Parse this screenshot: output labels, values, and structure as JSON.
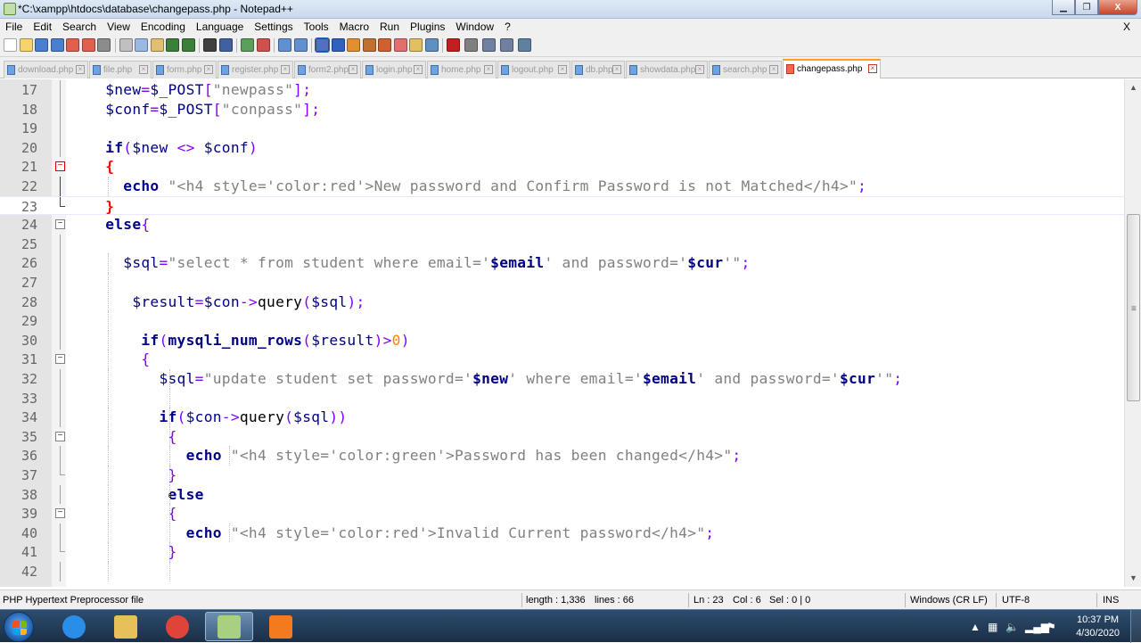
{
  "window": {
    "title": "*C:\\xampp\\htdocs\\database\\changepass.php - Notepad++",
    "app_icon": "notepadpp-icon",
    "buttons": [
      "minimize-icon",
      "maximize-icon",
      "close-icon"
    ],
    "close_glyph": "X"
  },
  "menubar": {
    "items": [
      "File",
      "Edit",
      "Search",
      "View",
      "Encoding",
      "Language",
      "Settings",
      "Tools",
      "Macro",
      "Run",
      "Plugins",
      "Window",
      "?"
    ],
    "close_doc": "X"
  },
  "toolbar": {
    "icons": [
      "new-file-icon",
      "open-file-icon",
      "save-icon",
      "save-all-icon",
      "close-icon",
      "close-all-icon",
      "print-icon",
      "cut-icon",
      "copy-icon",
      "paste-icon",
      "undo-icon",
      "redo-icon",
      "find-icon",
      "replace-icon",
      "zoom-in-icon",
      "zoom-out-icon",
      "sync-vertical-icon",
      "sync-horizontal-icon",
      "word-wrap-icon",
      "all-chars-icon",
      "indent-guide-icon",
      "user-lang-icon",
      "doc-map-icon",
      "function-list-icon",
      "folder-workspace-icon",
      "monitoring-icon",
      "record-macro-icon",
      "stop-record-icon",
      "playback-icon",
      "run-macro-multiple-icon",
      "save-macro-icon"
    ]
  },
  "tabs": [
    {
      "label": "download.php",
      "active": false
    },
    {
      "label": "file.php",
      "active": false
    },
    {
      "label": "form.php",
      "active": false
    },
    {
      "label": "register.php",
      "active": false
    },
    {
      "label": "form2.php",
      "active": false
    },
    {
      "label": "login.php",
      "active": false
    },
    {
      "label": "home.php",
      "active": false
    },
    {
      "label": "logout.php",
      "active": false
    },
    {
      "label": "db.php",
      "active": false
    },
    {
      "label": "showdata.php",
      "active": false
    },
    {
      "label": "search.php",
      "active": false
    },
    {
      "label": "changepass.php",
      "active": true
    }
  ],
  "editor": {
    "lines": [
      {
        "n": "17",
        "fold": "line",
        "tokens": [
          [
            "",
            "    "
          ],
          [
            "var",
            "$new"
          ],
          [
            "op",
            "="
          ],
          [
            "var",
            "$_POST"
          ],
          [
            "op",
            "["
          ],
          [
            "str",
            "\"newpass\""
          ],
          [
            "op",
            "];"
          ]
        ]
      },
      {
        "n": "18",
        "fold": "line",
        "tokens": [
          [
            "",
            "    "
          ],
          [
            "var",
            "$conf"
          ],
          [
            "op",
            "="
          ],
          [
            "var",
            "$_POST"
          ],
          [
            "op",
            "["
          ],
          [
            "str",
            "\"conpass\""
          ],
          [
            "op",
            "];"
          ]
        ]
      },
      {
        "n": "19",
        "fold": "line",
        "tokens": []
      },
      {
        "n": "20",
        "fold": "line",
        "tokens": [
          [
            "",
            "    "
          ],
          [
            "kw",
            "if"
          ],
          [
            "op",
            "("
          ],
          [
            "var",
            "$new"
          ],
          [
            "",
            " "
          ],
          [
            "op",
            "<>"
          ],
          [
            "",
            " "
          ],
          [
            "var",
            "$conf"
          ],
          [
            "op",
            ")"
          ]
        ]
      },
      {
        "n": "21",
        "fold": "box-red",
        "tokens": [
          [
            "",
            "    "
          ],
          [
            "brace-hl",
            "{"
          ]
        ]
      },
      {
        "n": "22",
        "fold": "line-red",
        "tokens": [
          [
            "",
            "      "
          ],
          [
            "kw",
            "echo"
          ],
          [
            "",
            " "
          ],
          [
            "str",
            "\"<h4 style='color:red'>New password and Confirm Password is not Matched</h4>\""
          ],
          [
            "op",
            ";"
          ]
        ]
      },
      {
        "n": "23",
        "fold": "end-red",
        "caret": true,
        "tokens": [
          [
            "",
            "    "
          ],
          [
            "brace-hl",
            "}"
          ]
        ]
      },
      {
        "n": "24",
        "fold": "box",
        "tokens": [
          [
            "",
            "    "
          ],
          [
            "kw",
            "else"
          ],
          [
            "brace",
            "{"
          ]
        ]
      },
      {
        "n": "25",
        "fold": "line",
        "tokens": []
      },
      {
        "n": "26",
        "fold": "line",
        "tokens": [
          [
            "",
            "      "
          ],
          [
            "var",
            "$sql"
          ],
          [
            "op",
            "="
          ],
          [
            "str",
            "\"select * from student where email='"
          ],
          [
            "strv",
            "$email"
          ],
          [
            "str",
            "' and password='"
          ],
          [
            "strv",
            "$cur"
          ],
          [
            "str",
            "'\""
          ],
          [
            "op",
            ";"
          ]
        ]
      },
      {
        "n": "27",
        "fold": "line",
        "tokens": []
      },
      {
        "n": "28",
        "fold": "line",
        "tokens": [
          [
            "",
            "       "
          ],
          [
            "var",
            "$result"
          ],
          [
            "op",
            "="
          ],
          [
            "var",
            "$con"
          ],
          [
            "op",
            "->"
          ],
          [
            "",
            "query"
          ],
          [
            "op",
            "("
          ],
          [
            "var",
            "$sql"
          ],
          [
            "op",
            ");"
          ]
        ]
      },
      {
        "n": "29",
        "fold": "line",
        "tokens": []
      },
      {
        "n": "30",
        "fold": "line",
        "tokens": [
          [
            "",
            "        "
          ],
          [
            "kw",
            "if"
          ],
          [
            "op",
            "("
          ],
          [
            "fn",
            "mysqli_num_rows"
          ],
          [
            "op",
            "("
          ],
          [
            "var",
            "$result"
          ],
          [
            "op",
            ")>"
          ],
          [
            "num",
            "0"
          ],
          [
            "op",
            ")"
          ]
        ]
      },
      {
        "n": "31",
        "fold": "box",
        "tokens": [
          [
            "",
            "        "
          ],
          [
            "brace",
            "{"
          ]
        ]
      },
      {
        "n": "32",
        "fold": "line",
        "tokens": [
          [
            "",
            "          "
          ],
          [
            "var",
            "$sql"
          ],
          [
            "op",
            "="
          ],
          [
            "str",
            "\"update student set password='"
          ],
          [
            "strv",
            "$new"
          ],
          [
            "str",
            "' where email='"
          ],
          [
            "strv",
            "$email"
          ],
          [
            "str",
            "' and password='"
          ],
          [
            "strv",
            "$cur"
          ],
          [
            "str",
            "'\""
          ],
          [
            "op",
            ";"
          ]
        ]
      },
      {
        "n": "33",
        "fold": "line",
        "tokens": []
      },
      {
        "n": "34",
        "fold": "line",
        "tokens": [
          [
            "",
            "          "
          ],
          [
            "kw",
            "if"
          ],
          [
            "op",
            "("
          ],
          [
            "var",
            "$con"
          ],
          [
            "op",
            "->"
          ],
          [
            "",
            "query"
          ],
          [
            "op",
            "("
          ],
          [
            "var",
            "$sql"
          ],
          [
            "op",
            "))"
          ]
        ]
      },
      {
        "n": "35",
        "fold": "box",
        "tokens": [
          [
            "",
            "           "
          ],
          [
            "brace",
            "{"
          ]
        ]
      },
      {
        "n": "36",
        "fold": "line",
        "tokens": [
          [
            "",
            "             "
          ],
          [
            "kw",
            "echo"
          ],
          [
            "",
            " "
          ],
          [
            "str",
            "\"<h4 style='color:green'>Password has been changed</h4>\""
          ],
          [
            "op",
            ";"
          ]
        ]
      },
      {
        "n": "37",
        "fold": "end",
        "tokens": [
          [
            "",
            "           "
          ],
          [
            "brace",
            "}"
          ]
        ]
      },
      {
        "n": "38",
        "fold": "line",
        "tokens": [
          [
            "",
            "           "
          ],
          [
            "kw",
            "else"
          ]
        ]
      },
      {
        "n": "39",
        "fold": "box",
        "tokens": [
          [
            "",
            "           "
          ],
          [
            "brace",
            "{"
          ]
        ]
      },
      {
        "n": "40",
        "fold": "line",
        "tokens": [
          [
            "",
            "             "
          ],
          [
            "kw",
            "echo"
          ],
          [
            "",
            " "
          ],
          [
            "str",
            "\"<h4 style='color:red'>Invalid Current password</h4>\""
          ],
          [
            "op",
            ";"
          ]
        ]
      },
      {
        "n": "41",
        "fold": "end",
        "tokens": [
          [
            "",
            "           "
          ],
          [
            "brace",
            "}"
          ]
        ]
      },
      {
        "n": "42",
        "fold": "line",
        "tokens": []
      }
    ]
  },
  "statusbar": {
    "file_type": "PHP Hypertext Preprocessor file",
    "length": "length : 1,336",
    "lines": "lines : 66",
    "ln": "Ln : 23",
    "col": "Col : 6",
    "sel": "Sel : 0 | 0",
    "eol": "Windows (CR LF)",
    "encoding": "UTF-8",
    "mode": "INS"
  },
  "taskbar": {
    "items": [
      {
        "name": "internet-explorer-icon",
        "active": false
      },
      {
        "name": "file-explorer-icon",
        "active": false
      },
      {
        "name": "chrome-icon",
        "active": false
      },
      {
        "name": "notepadpp-icon",
        "active": true
      },
      {
        "name": "xampp-icon",
        "active": false
      }
    ],
    "time": "10:37 PM",
    "date": "4/30/2020"
  }
}
